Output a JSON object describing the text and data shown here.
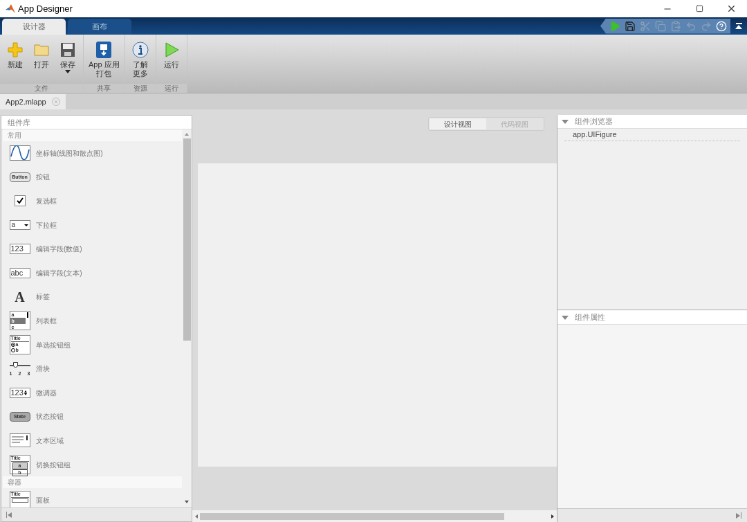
{
  "window": {
    "title": "App Designer"
  },
  "ribbon_tabs": [
    {
      "label": "设计器",
      "selected": true
    },
    {
      "label": "画布",
      "selected": false
    }
  ],
  "quick_access": [
    {
      "kind": "run",
      "disabled": false
    },
    {
      "kind": "save",
      "disabled": false
    },
    {
      "kind": "cut",
      "disabled": true
    },
    {
      "kind": "copy",
      "disabled": true
    },
    {
      "kind": "paste",
      "disabled": true
    },
    {
      "kind": "undo",
      "disabled": true
    },
    {
      "kind": "redo",
      "disabled": true
    },
    {
      "kind": "help",
      "disabled": false
    }
  ],
  "ribbon_groups": [
    {
      "label": "文件",
      "buttons": [
        {
          "kind": "new",
          "lines": [
            "新建"
          ],
          "dropdown": false
        },
        {
          "kind": "open",
          "lines": [
            "打开"
          ],
          "dropdown": false
        },
        {
          "kind": "save",
          "lines": [
            "保存"
          ],
          "dropdown": true
        }
      ]
    },
    {
      "label": "共享",
      "buttons": [
        {
          "kind": "package",
          "lines": [
            "App 应用",
            "打包"
          ],
          "dropdown": false
        }
      ]
    },
    {
      "label": "资源",
      "buttons": [
        {
          "kind": "info",
          "lines": [
            "了解",
            "更多"
          ],
          "dropdown": false
        }
      ]
    },
    {
      "label": "运行",
      "buttons": [
        {
          "kind": "run",
          "lines": [
            "运行"
          ],
          "dropdown": false
        }
      ]
    }
  ],
  "document_tabs": [
    {
      "label": "App2.mlapp",
      "selected": true
    }
  ],
  "component_library": {
    "title": "组件库",
    "sections": [
      {
        "label": "常用",
        "items": [
          {
            "kind": "axes",
            "label": "坐标轴(线图和散点图)"
          },
          {
            "kind": "button",
            "label": "按钮",
            "icon_text": [
              "Button"
            ]
          },
          {
            "kind": "checkbox",
            "label": "复选框"
          },
          {
            "kind": "dropdown",
            "label": "下拉框",
            "icon_text": [
              "a"
            ]
          },
          {
            "kind": "field",
            "label": "编辑字段(数值)",
            "icon_text": [
              "123"
            ]
          },
          {
            "kind": "field",
            "label": "编辑字段(文本)",
            "icon_text": [
              "abc"
            ]
          },
          {
            "kind": "label",
            "label": "标签",
            "icon_text": [
              "A"
            ]
          },
          {
            "kind": "listbox",
            "label": "列表框",
            "icon_text": [
              "a",
              "b",
              "c"
            ]
          },
          {
            "kind": "radiogroup",
            "label": "单选按钮组",
            "icon_text": [
              "Title",
              "a",
              "b"
            ]
          },
          {
            "kind": "slider",
            "label": "滑块",
            "icon_text": [
              "1",
              "2",
              "3"
            ]
          },
          {
            "kind": "spinner",
            "label": "微调器",
            "icon_text": [
              "123"
            ]
          },
          {
            "kind": "state",
            "label": "状态按钮",
            "icon_text": [
              "State"
            ]
          },
          {
            "kind": "textarea",
            "label": "文本区域"
          },
          {
            "kind": "togglegroup",
            "label": "切换按钮组",
            "icon_text": [
              "Title",
              "a",
              "b"
            ]
          }
        ]
      },
      {
        "label": "容器",
        "items": [
          {
            "kind": "panel",
            "label": "面板",
            "icon_text": [
              "Title"
            ]
          }
        ]
      }
    ]
  },
  "view_switch": [
    {
      "label": "设计视图",
      "selected": true
    },
    {
      "label": "代码视图",
      "selected": false
    }
  ],
  "component_browser": {
    "title": "组件浏览器",
    "expanded": true,
    "items": [
      "app.UIFigure"
    ]
  },
  "component_properties": {
    "title": "组件属性",
    "expanded": true
  }
}
